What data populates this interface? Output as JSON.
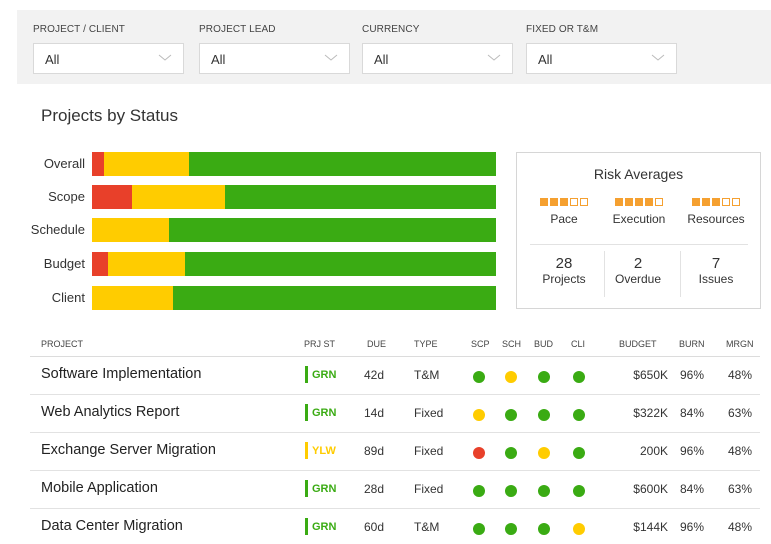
{
  "filters": [
    {
      "label": "PROJECT / CLIENT",
      "value": "All"
    },
    {
      "label": "PROJECT LEAD",
      "value": "All"
    },
    {
      "label": "CURRENCY",
      "value": "All"
    },
    {
      "label": "FIXED OR T&M",
      "value": "All"
    }
  ],
  "status_section": {
    "title": "Projects by Status",
    "bars": [
      {
        "label": "Overall",
        "red": 3,
        "yellow": 21,
        "green": 76
      },
      {
        "label": "Scope",
        "red": 10,
        "yellow": 23,
        "green": 67
      },
      {
        "label": "Schedule",
        "red": 0,
        "yellow": 19,
        "green": 81
      },
      {
        "label": "Budget",
        "red": 4,
        "yellow": 19,
        "green": 77
      },
      {
        "label": "Client",
        "red": 0,
        "yellow": 20,
        "green": 80
      }
    ]
  },
  "risk": {
    "title": "Risk Averages",
    "items": [
      {
        "label": "Pace",
        "filled": 3,
        "total": 5
      },
      {
        "label": "Execution",
        "filled": 4,
        "total": 5
      },
      {
        "label": "Resources",
        "filled": 3,
        "total": 5
      }
    ],
    "stats": [
      {
        "value": "28",
        "label": "Projects"
      },
      {
        "value": "2",
        "label": "Overdue"
      },
      {
        "value": "7",
        "label": "Issues"
      }
    ]
  },
  "table": {
    "headers": {
      "project": "PROJECT",
      "prj_st": "PRJ ST",
      "due": "DUE",
      "type": "TYPE",
      "scp": "SCP",
      "sch": "SCH",
      "bud": "BUD",
      "cli": "CLI",
      "budget": "BUDGET",
      "burn": "BURN",
      "mrgn": "MRGN"
    },
    "rows": [
      {
        "project": "Software Implementation",
        "status": "GRN",
        "due": "42d",
        "type": "T&M",
        "scp": "green",
        "sch": "yellow",
        "bud": "green",
        "cli": "green",
        "budget": "$650K",
        "burn": "96%",
        "mrgn": "48%"
      },
      {
        "project": "Web Analytics Report",
        "status": "GRN",
        "due": "14d",
        "type": "Fixed",
        "scp": "yellow",
        "sch": "green",
        "bud": "green",
        "cli": "green",
        "budget": "$322K",
        "burn": "84%",
        "mrgn": "63%"
      },
      {
        "project": "Exchange Server Migration",
        "status": "YLW",
        "due": "89d",
        "type": "Fixed",
        "scp": "red",
        "sch": "green",
        "bud": "yellow",
        "cli": "green",
        "budget": "200K",
        "burn": "96%",
        "mrgn": "48%"
      },
      {
        "project": "Mobile Application",
        "status": "GRN",
        "due": "28d",
        "type": "Fixed",
        "scp": "green",
        "sch": "green",
        "bud": "green",
        "cli": "green",
        "budget": "$600K",
        "burn": "84%",
        "mrgn": "63%"
      },
      {
        "project": "Data Center Migration",
        "status": "GRN",
        "due": "60d",
        "type": "T&M",
        "scp": "green",
        "sch": "green",
        "bud": "green",
        "cli": "yellow",
        "budget": "$144K",
        "burn": "96%",
        "mrgn": "48%"
      }
    ]
  },
  "colors": {
    "red": "#e8402a",
    "yellow": "#ffcc00",
    "green": "#3aab13",
    "orange": "#f5a030",
    "status_green": "#3aab13",
    "status_yellow": "#ffcc00"
  }
}
